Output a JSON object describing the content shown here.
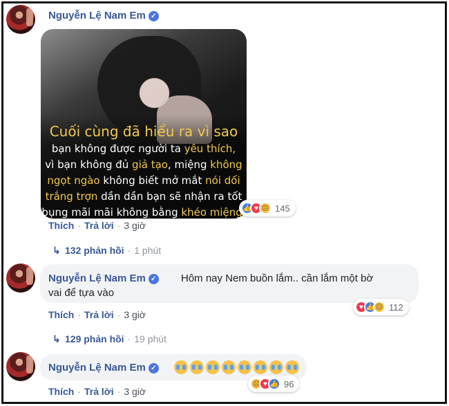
{
  "comments": [
    {
      "author": "Nguyễn Lệ Nam Em",
      "verified_icon": "verified-check-icon",
      "photo": {
        "caption_lines": [
          {
            "parts": [
              {
                "text": "Cuối cùng đã hiểu ra vì sao",
                "hl": true
              }
            ]
          },
          {
            "parts": [
              {
                "text": "bạn không được người ta ",
                "hl": false
              },
              {
                "text": "yêu thích,",
                "hl": true
              }
            ]
          },
          {
            "parts": [
              {
                "text": "vì bạn không đủ ",
                "hl": false
              },
              {
                "text": "giả tạo",
                "hl": true
              },
              {
                "text": ", miệng ",
                "hl": false
              },
              {
                "text": "không",
                "hl": true
              }
            ]
          },
          {
            "parts": [
              {
                "text": "ngọt ngào",
                "hl": true
              },
              {
                "text": " không biết mở mắt ",
                "hl": false
              },
              {
                "text": "nói dối",
                "hl": true
              }
            ]
          },
          {
            "parts": [
              {
                "text": "trắng trợn",
                "hl": true
              },
              {
                "text": " dần dần bạn sẽ nhận ra tốt",
                "hl": false
              }
            ]
          },
          {
            "parts": [
              {
                "text": "bụng mãi mãi không bằng ",
                "hl": false
              },
              {
                "text": "khéo miệng.",
                "hl": true
              }
            ]
          }
        ]
      },
      "reactions": {
        "types": [
          "like",
          "love",
          "sad"
        ],
        "count": "145"
      },
      "actions": {
        "like": "Thích",
        "reply": "Trả lời",
        "time": "3 giờ"
      },
      "replies": {
        "label": "132 phản hồi",
        "time": "1 phút"
      }
    },
    {
      "author": "Nguyễn Lệ Nam Em",
      "text_line1": "Hôm nay Nem buồn lắm.. cần lắm một bờ",
      "text_line2": "vai để tựa vào",
      "reactions": {
        "types": [
          "love",
          "like",
          "sad"
        ],
        "count": "112"
      },
      "actions": {
        "like": "Thích",
        "reply": "Trả lời",
        "time": "3 giờ"
      },
      "replies": {
        "label": "129 phản hồi",
        "time": "19 phút"
      }
    },
    {
      "author": "Nguyễn Lệ Nam Em",
      "emoji_icon": "crying-face-icon",
      "emoji_count": 8,
      "reactions": {
        "types": [
          "sad",
          "love",
          "like"
        ],
        "count": "96"
      },
      "actions": {
        "like": "Thích",
        "reply": "Trả lời",
        "time": "3 giờ"
      }
    }
  ],
  "colors": {
    "link": "#385898",
    "highlight": "#f2c94c",
    "bubble": "#f2f3f5"
  }
}
